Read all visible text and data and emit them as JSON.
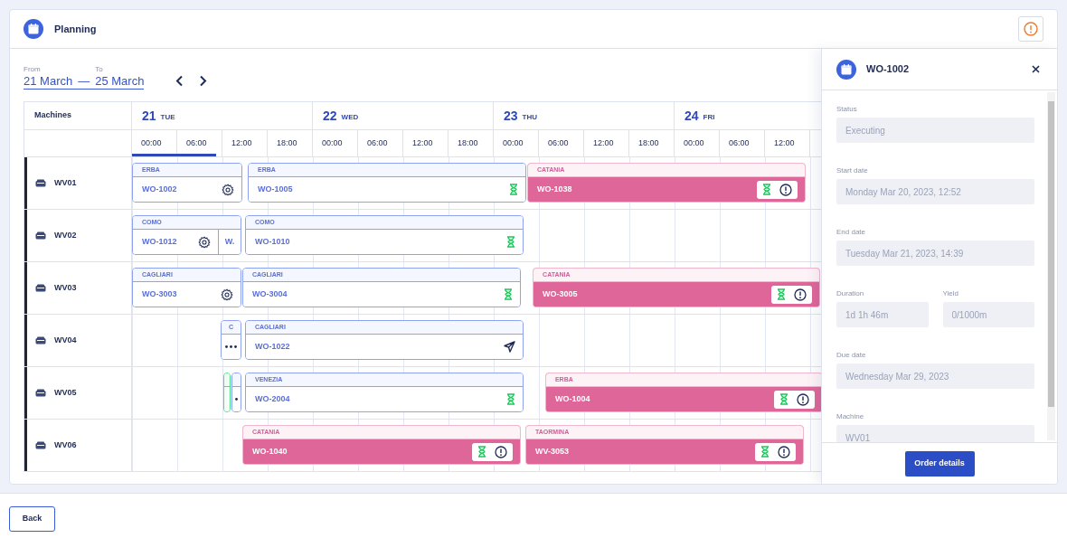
{
  "header": {
    "title": "Planning"
  },
  "range": {
    "from_label": "From",
    "from": "21 March",
    "separator": "—",
    "to_label": "To",
    "to": "25 March"
  },
  "grid": {
    "machines_heading": "Machines",
    "days": [
      {
        "number": "21",
        "weekday": "TUE"
      },
      {
        "number": "22",
        "weekday": "WED"
      },
      {
        "number": "23",
        "weekday": "THU"
      },
      {
        "number": "24",
        "weekday": "FRI"
      }
    ],
    "times": [
      "00:00",
      "06:00",
      "12:00",
      "18:00",
      "00:00",
      "06:00",
      "12:00",
      "18:00",
      "00:00",
      "06:00",
      "12:00",
      "18:00",
      "00:00",
      "06:00",
      "12:00"
    ]
  },
  "machines": [
    {
      "name": "WV01",
      "orders": [
        {
          "location": "ERBA",
          "code": "WO-1002",
          "kind": "setup"
        },
        {
          "location": "ERBA",
          "code": "WO-1005",
          "kind": "waiting"
        },
        {
          "location": "CATANIA",
          "code": "WO-1038",
          "kind": "late"
        }
      ]
    },
    {
      "name": "WV02",
      "orders": [
        {
          "location": "COMO",
          "code": "WO-1012",
          "kind": "setup",
          "tail": "W."
        },
        {
          "location": "COMO",
          "code": "WO-1010",
          "kind": "waiting"
        }
      ]
    },
    {
      "name": "WV03",
      "orders": [
        {
          "location": "CAGLIARI",
          "code": "WO-3003",
          "kind": "setup"
        },
        {
          "location": "CAGLIARI",
          "code": "WO-3004",
          "kind": "waiting"
        },
        {
          "location": "CATANIA",
          "code": "WO-3005",
          "kind": "late"
        }
      ]
    },
    {
      "name": "WV04",
      "orders": [
        {
          "location": "C",
          "kind": "more"
        },
        {
          "location": "CAGLIARI",
          "code": "WO-1022",
          "kind": "sent"
        }
      ]
    },
    {
      "name": "WV05",
      "orders": [
        {
          "kind": "done"
        },
        {
          "kind": "marked"
        },
        {
          "location": "VENEZIA",
          "code": "WO-2004",
          "kind": "waiting"
        },
        {
          "location": "ERBA",
          "code": "WO-1004",
          "kind": "late"
        }
      ]
    },
    {
      "name": "WV06",
      "orders": [
        {
          "location": "CATANIA",
          "code": "WO-1040",
          "kind": "late"
        },
        {
          "location": "TAORMINA",
          "code": "WV-3053",
          "kind": "late"
        }
      ]
    }
  ],
  "panel": {
    "title": "WO-1002",
    "field_rows": [
      {
        "fields": [
          {
            "label": "Status",
            "value": "Executing",
            "disabled": true
          }
        ]
      },
      {
        "fields": [
          {
            "label": "Start date",
            "value": "Monday Mar 20, 2023, 12:52",
            "disabled": true
          }
        ]
      },
      {
        "fields": [
          {
            "label": "End date",
            "value": "Tuesday Mar 21, 2023, 14:39",
            "disabled": true
          }
        ]
      },
      {
        "fields": [
          {
            "label": "Duration",
            "value": "1d 1h 46m",
            "disabled": true
          },
          {
            "label": "Yield",
            "value": "0/1000m",
            "disabled": true
          }
        ]
      },
      {
        "fields": [
          {
            "label": "Due date",
            "value": "Wednesday Mar 29, 2023",
            "disabled": true
          }
        ]
      },
      {
        "fields": [
          {
            "label": "Machine",
            "value": "WV01",
            "disabled": true
          }
        ]
      }
    ],
    "button": "Order details"
  },
  "back_button": "Back"
}
